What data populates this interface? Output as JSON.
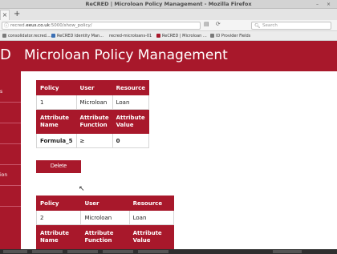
{
  "window": {
    "title": "ReCRED | Microloan Policy Management - Mozilla Firefox",
    "minimize": "–",
    "close": "×"
  },
  "tabs": {
    "active_label": "×",
    "new_tab": "+"
  },
  "url": {
    "prefix": "recred.",
    "host": "eeus.co.uk",
    "path": ":5000/show_policy/",
    "search_placeholder": "Search"
  },
  "bookmarks": [
    {
      "label": "consolidator.recred....",
      "color": "#7a7a7a"
    },
    {
      "label": "ReCRED Identity Man...",
      "color": "#3a6fb5"
    },
    {
      "label": "recred-microloans-01",
      "color": "#7a7a7a"
    },
    {
      "label": "ReCRED | Microloan ...",
      "color": "#a8182b"
    },
    {
      "label": "ID Provider Fields",
      "color": "#7a7a7a"
    }
  ],
  "header": {
    "logo": "D",
    "title": "Microloan Policy Management"
  },
  "sidebar": {
    "items": [
      "s",
      "",
      "",
      "",
      "ion",
      ""
    ]
  },
  "policy1": {
    "headers": [
      "Policy",
      "User",
      "Resource"
    ],
    "values": [
      "1",
      "Microloan",
      "Loan"
    ],
    "attr_headers": [
      "Attribute Name",
      "Attribute Function",
      "Attribute Value"
    ],
    "attr_values": [
      "Formula_5",
      "≥",
      "0"
    ]
  },
  "delete_label": "Delete",
  "policy2": {
    "headers": [
      "Policy",
      "User",
      "Resource"
    ],
    "values": [
      "2",
      "Microloan",
      "Loan"
    ],
    "attr_headers": [
      "Attribute Name",
      "Attribute Function",
      "Attribute Value"
    ]
  },
  "colors": {
    "brand_red": "#a8182b",
    "page_bg": "#ffffff"
  },
  "icons": {
    "page_info": "info-icon",
    "reader": "reader-view-icon",
    "reload": "reload-icon",
    "search": "search-icon"
  }
}
